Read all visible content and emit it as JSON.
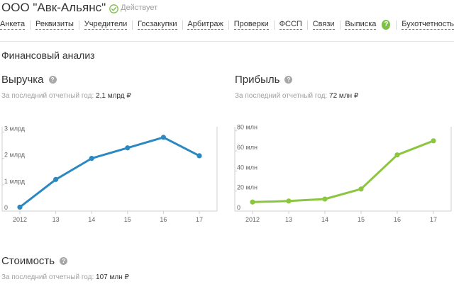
{
  "header": {
    "company_name": "ООО \"Авк-Альянс\"",
    "status_icon": "check-circle-icon",
    "status": "Действует"
  },
  "nav": {
    "items": [
      "Анкета",
      "Реквизиты",
      "Учредители",
      "Госзакупки",
      "Арбитраж",
      "Проверки",
      "ФССП",
      "Связи",
      "Выписка",
      "Бухотчетность"
    ],
    "help_label": "?",
    "help_after_index": 8
  },
  "financial_analysis": {
    "title": "Финансовый анализ"
  },
  "revenue": {
    "title": "Выручка",
    "subtitle": "За последний отчетный год:",
    "value": "2,1 млрд ₽"
  },
  "profit": {
    "title": "Прибыль",
    "subtitle": "За последний отчетный год:",
    "value": "72 млн ₽"
  },
  "cost": {
    "title": "Стоимость",
    "subtitle": "За последний отчетный год:",
    "value": "107 млн ₽"
  },
  "colors": {
    "revenue_line": "#2b88c0",
    "profit_line": "#8cc63f",
    "status_icon": "#7cc242",
    "help_badge": "#7cc242",
    "axis": "#cfcfcf",
    "tick_text": "#666666"
  },
  "chart_data": [
    {
      "type": "line",
      "title": "Выручка",
      "x": [
        "2012",
        "13",
        "14",
        "15",
        "16",
        "17"
      ],
      "series": [
        {
          "values": [
            0.15,
            1.2,
            2.0,
            2.4,
            2.8,
            2.1
          ]
        }
      ],
      "y_ticks": [
        0,
        1,
        2,
        3
      ],
      "y_tick_labels": [
        "0",
        "1 млрд",
        "2 млрд",
        "3 млрд"
      ],
      "ylim": [
        0,
        3.2
      ],
      "grid": false
    },
    {
      "type": "line",
      "title": "Прибыль",
      "x": [
        "2012",
        "13",
        "14",
        "15",
        "16",
        "17"
      ],
      "series": [
        {
          "values": [
            9,
            10,
            12,
            22,
            56,
            70
          ]
        }
      ],
      "y_ticks": [
        0,
        20,
        40,
        60,
        80
      ],
      "y_tick_labels": [
        "0",
        "20 млн",
        "40 млн",
        "60 млн",
        "80 млн"
      ],
      "ylim": [
        0,
        84
      ],
      "grid": false
    }
  ]
}
